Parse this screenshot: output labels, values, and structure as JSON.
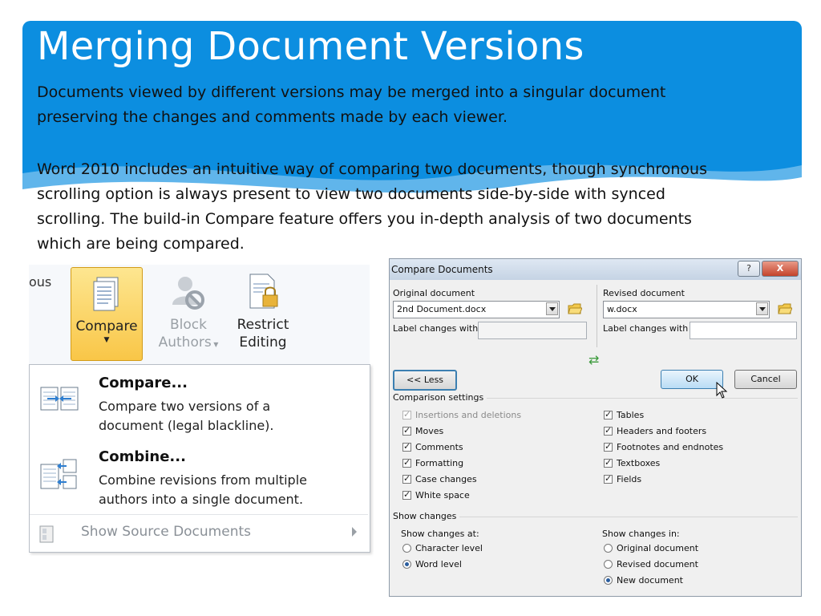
{
  "slide": {
    "title": "Merging Document Versions",
    "paragraph1_line1": "Documents viewed by different versions may be merged into a singular document",
    "paragraph1_line2": "preserving the changes and comments made by each viewer.",
    "paragraph2_line1": "Word 2010 includes an intuitive way of comparing two documents, though synchronous",
    "paragraph2_line2": "scrolling option is always present to view two documents side-by-side with synced",
    "paragraph2_line3": "scrolling. The build-in Compare feature offers you in-depth analysis of two documents",
    "paragraph2_line4": "which are being compared.",
    "accent_color": "#0c8ee0"
  },
  "ribbon": {
    "partial_label": "ous",
    "compare_label": "Compare",
    "block_line1": "Block",
    "block_line2": "Authors",
    "restrict_line1": "Restrict",
    "restrict_line2": "Editing"
  },
  "menu": {
    "compare_title": "Compare...",
    "compare_desc": "Compare two versions of a\ndocument (legal blackline).",
    "combine_title": "Combine...",
    "combine_desc": "Combine revisions from multiple\nauthors into a single document.",
    "show_source": "Show Source Documents"
  },
  "dialog": {
    "title": "Compare Documents",
    "help_label": "?",
    "close_label": "X",
    "original_label": "Original document",
    "original_value": "2nd Document.docx",
    "original_label_changes": "Label changes with",
    "revised_label": "Revised document",
    "revised_value": "w.docx",
    "revised_label_changes": "Label changes with",
    "less_button": "<< Less",
    "ok_button": "OK",
    "cancel_button": "Cancel",
    "comparison_settings": "Comparison settings",
    "settings_left": [
      {
        "label": "Insertions and deletions",
        "checked": true,
        "disabled": true
      },
      {
        "label": "Moves",
        "checked": true,
        "disabled": false
      },
      {
        "label": "Comments",
        "checked": true,
        "disabled": false
      },
      {
        "label": "Formatting",
        "checked": true,
        "disabled": false
      },
      {
        "label": "Case changes",
        "checked": true,
        "disabled": false
      },
      {
        "label": "White space",
        "checked": true,
        "disabled": false
      }
    ],
    "settings_right": [
      {
        "label": "Tables",
        "checked": true
      },
      {
        "label": "Headers and footers",
        "checked": true
      },
      {
        "label": "Footnotes and endnotes",
        "checked": true
      },
      {
        "label": "Textboxes",
        "checked": true
      },
      {
        "label": "Fields",
        "checked": true
      }
    ],
    "show_changes": "Show changes",
    "show_changes_at": "Show changes at:",
    "at_options": [
      {
        "label": "Character level",
        "selected": false
      },
      {
        "label": "Word level",
        "selected": true
      }
    ],
    "show_changes_in": "Show changes in:",
    "in_options": [
      {
        "label": "Original document",
        "selected": false
      },
      {
        "label": "Revised document",
        "selected": false
      },
      {
        "label": "New document",
        "selected": true
      }
    ]
  }
}
